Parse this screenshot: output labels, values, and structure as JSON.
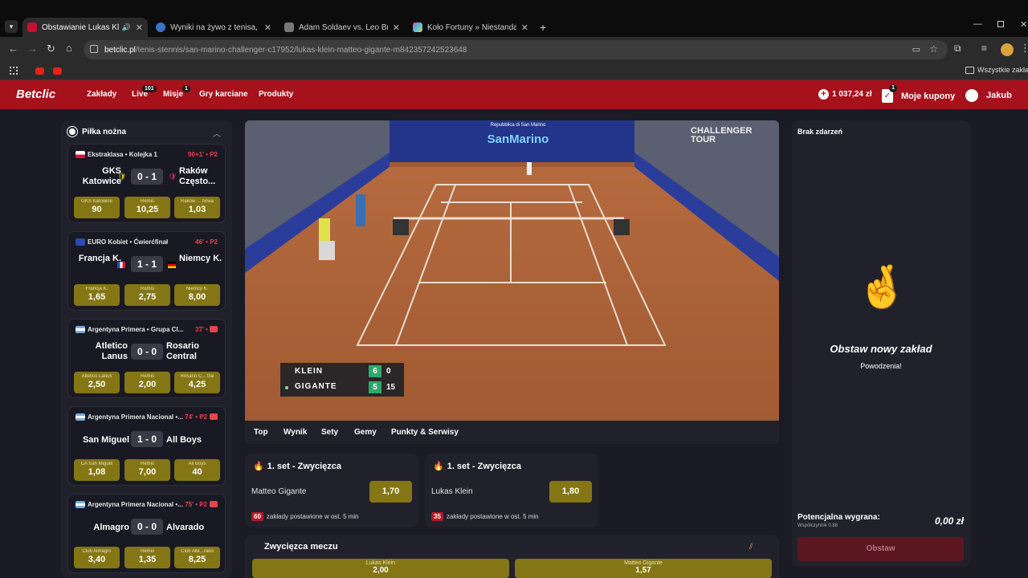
{
  "browser": {
    "tabs": [
      {
        "title": "Obstawianie Lukas Klein - Matteo Gigante",
        "fav_color": "#c8102e"
      },
      {
        "title": "Wyniki na żywo z tenisa, tenis ATP",
        "fav_color": "#3a73c4"
      },
      {
        "title": "Adam Soldaev vs. Leo Brichta, Kokom",
        "fav_color": "#777777"
      },
      {
        "title": "Koło Fortuny » Niestandardowy",
        "fav_color": "#e04b8a"
      }
    ],
    "url_domain": "betclic.pl",
    "url_path": "/tenis-stennis/san-marino-challenger-c17952/lukas-klein-matteo-gigante-m842357242523648",
    "bookmarks_label": "Wszystkie zakładki"
  },
  "header": {
    "logo": "Betclic",
    "nav": [
      {
        "label": "Zakłady",
        "badge": ""
      },
      {
        "label": "Live",
        "badge": "101"
      },
      {
        "label": "Misje",
        "badge": "1"
      },
      {
        "label": "Gry karciane",
        "badge": ""
      },
      {
        "label": "Produkty",
        "badge": ""
      }
    ],
    "balance": "1 037,24 zł",
    "coupons_label": "Moje kupony",
    "coupons_badge": "1",
    "user": "Jakub"
  },
  "sidebar": {
    "sport": "Piłka nożna",
    "matches": [
      {
        "league": "Ekstraklasa • Kolejka 1",
        "time": "90+1' • P2",
        "home": "GKS Katowice",
        "away": "Raków Często...",
        "score": "0 - 1",
        "odds": [
          {
            "label": "GKS Katowice",
            "value": "90"
          },
          {
            "label": "Remis",
            "value": "10,25"
          },
          {
            "label": "Raków ... howa",
            "value": "1,03"
          }
        ]
      },
      {
        "league": "EURO Kobiet • Ćwierćfinał",
        "time": "46' • P2",
        "home": "Francja K.",
        "away": "Niemcy K.",
        "score": "1 - 1",
        "odds": [
          {
            "label": "Francja K.",
            "value": "1,65"
          },
          {
            "label": "Remis",
            "value": "2,75"
          },
          {
            "label": "Niemcy K.",
            "value": "8,00"
          }
        ]
      },
      {
        "league": "Argentyna Primera • Grupa Cl...",
        "time": "37' • P1",
        "home": "Atletico Lanus",
        "away": "Rosario Central",
        "score": "0 - 0",
        "odds": [
          {
            "label": "Atletico Lanus",
            "value": "2,50"
          },
          {
            "label": "Remis",
            "value": "2,00"
          },
          {
            "label": "Rosario C... tral",
            "value": "4,25"
          }
        ]
      },
      {
        "league": "Argentyna Primera Nacional •...",
        "time": "74' • P2",
        "home": "San Miguel",
        "away": "All Boys",
        "score": "1 - 0",
        "odds": [
          {
            "label": "CA San Miguel",
            "value": "1,08"
          },
          {
            "label": "Remis",
            "value": "7,00"
          },
          {
            "label": "All Boys",
            "value": "40"
          }
        ]
      },
      {
        "league": "Argentyna Primera Nacional •...",
        "time": "75' • P2",
        "home": "Almagro",
        "away": "Alvarado",
        "score": "0 - 0",
        "odds": [
          {
            "label": "Club Almagro",
            "value": "3,40"
          },
          {
            "label": "Remis",
            "value": "1,35"
          },
          {
            "label": "Club Alle...rado",
            "value": "8,25"
          }
        ]
      }
    ]
  },
  "video": {
    "banner": "Repubblica di San Marino",
    "banner_brand": "SanMarino",
    "challenger_logo": "CHALLENGER TOUR",
    "scoreboard": [
      {
        "player": "KLEIN",
        "games": "6",
        "points": "0",
        "serving": false
      },
      {
        "player": "GIGANTE",
        "games": "5",
        "points": "15",
        "serving": true
      }
    ]
  },
  "event_tabs": [
    "Top",
    "Wynik",
    "Sety",
    "Gemy",
    "Punkty & Serwisy"
  ],
  "markets": [
    {
      "title": "1. set - Zwycięzca",
      "selection": "Matteo Gigante",
      "odd": "1,70",
      "count": "60",
      "count_text": "zakłady postawione w ost. 5 min"
    },
    {
      "title": "1. set - Zwycięzca",
      "selection": "Lukas Klein",
      "odd": "1,80",
      "count": "35",
      "count_text": "zakłady postawione w ost. 5 min"
    }
  ],
  "match_winner": {
    "title": "Zwycięzca meczu",
    "odds": [
      {
        "label": "Lukas Klein",
        "value": "2,00"
      },
      {
        "label": "Matteo Gigante",
        "value": "1,57"
      }
    ]
  },
  "betslip": {
    "empty_title": "Brak zdarzeń",
    "cta_title": "Obstaw nowy zakład",
    "cta_sub": "Powodzenia!",
    "potential_label": "Potencjalna wygrana:",
    "coef_label": "Współczynnik 0.88",
    "potential_value": "0,00 zł",
    "button": "Obstaw"
  }
}
